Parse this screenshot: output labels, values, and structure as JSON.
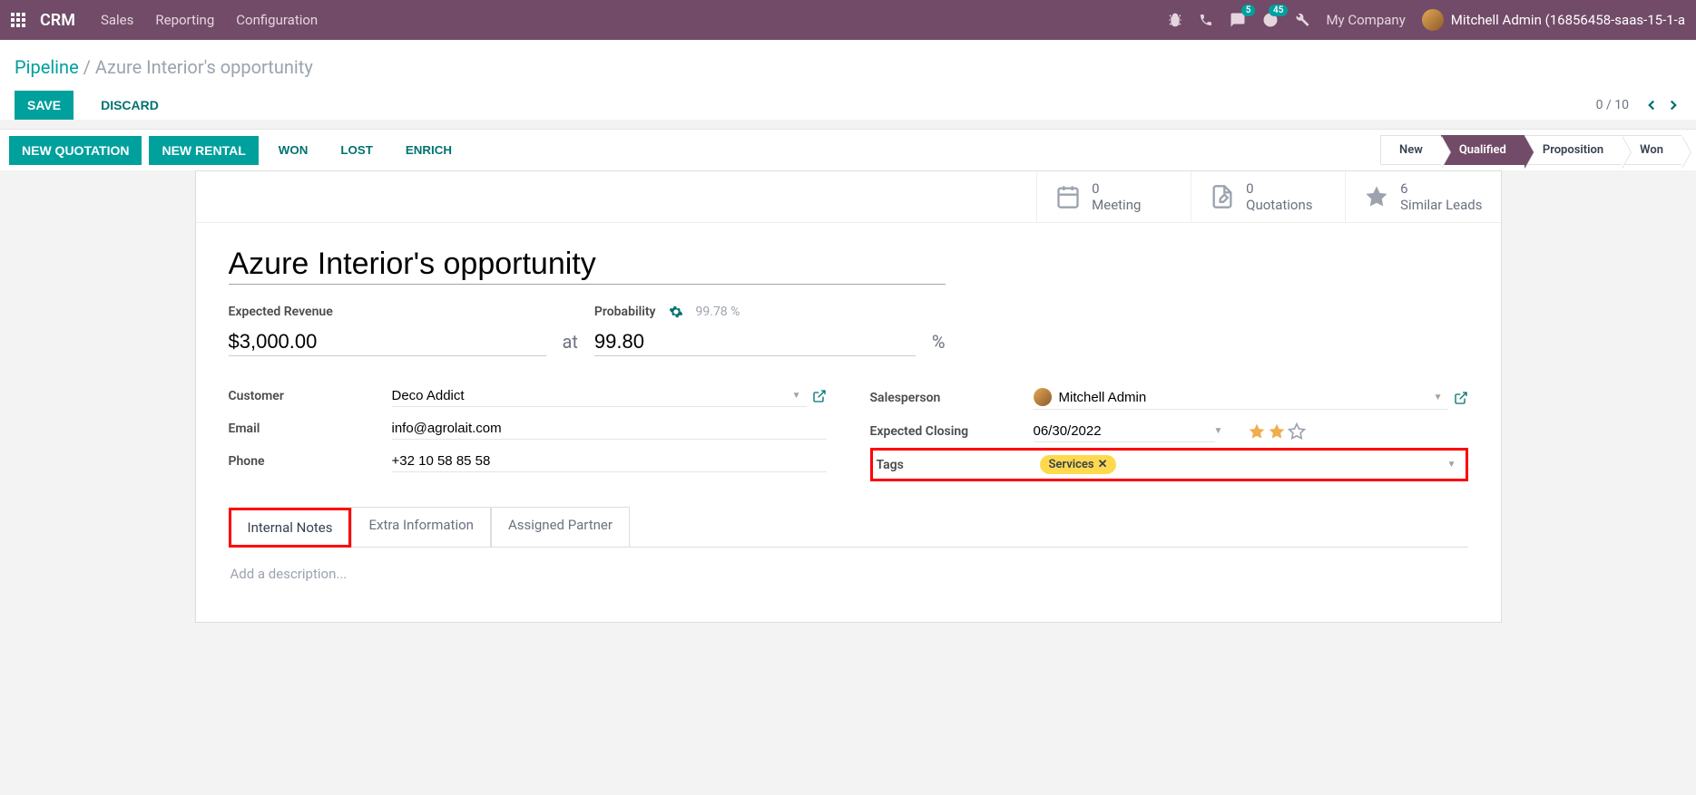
{
  "nav": {
    "brand": "CRM",
    "menu": [
      "Sales",
      "Reporting",
      "Configuration"
    ],
    "messages_count": "5",
    "activities_count": "45",
    "company": "My Company",
    "user": "Mitchell Admin (16856458-saas-15-1-a"
  },
  "breadcrumb": {
    "root": "Pipeline",
    "current": "Azure Interior's opportunity"
  },
  "cp": {
    "save": "Save",
    "discard": "Discard",
    "pager": "0 / 10"
  },
  "status_buttons": {
    "new_quotation": "New Quotation",
    "new_rental": "New Rental",
    "won": "Won",
    "lost": "Lost",
    "enrich": "Enrich"
  },
  "stages": [
    "New",
    "Qualified",
    "Proposition",
    "Won"
  ],
  "stats": {
    "meeting": {
      "count": "0",
      "label": "Meeting"
    },
    "quotations": {
      "count": "0",
      "label": "Quotations"
    },
    "similar": {
      "count": "6",
      "label": "Similar Leads"
    }
  },
  "record": {
    "title": "Azure Interior's opportunity",
    "expected_revenue_label": "Expected Revenue",
    "expected_revenue": "$3,000.00",
    "at": "at",
    "probability_label": "Probability",
    "probability_auto": "99.78 %",
    "probability": "99.80",
    "pct": "%",
    "customer_label": "Customer",
    "customer": "Deco Addict",
    "email_label": "Email",
    "email": "info@agrolait.com",
    "phone_label": "Phone",
    "phone": "+32 10 58 85 58",
    "salesperson_label": "Salesperson",
    "salesperson": "Mitchell Admin",
    "closing_label": "Expected Closing",
    "closing": "06/30/2022",
    "tags_label": "Tags",
    "tag_value": "Services"
  },
  "tabs": {
    "internal_notes": "Internal Notes",
    "extra_info": "Extra Information",
    "assigned_partner": "Assigned Partner"
  },
  "description_placeholder": "Add a description..."
}
